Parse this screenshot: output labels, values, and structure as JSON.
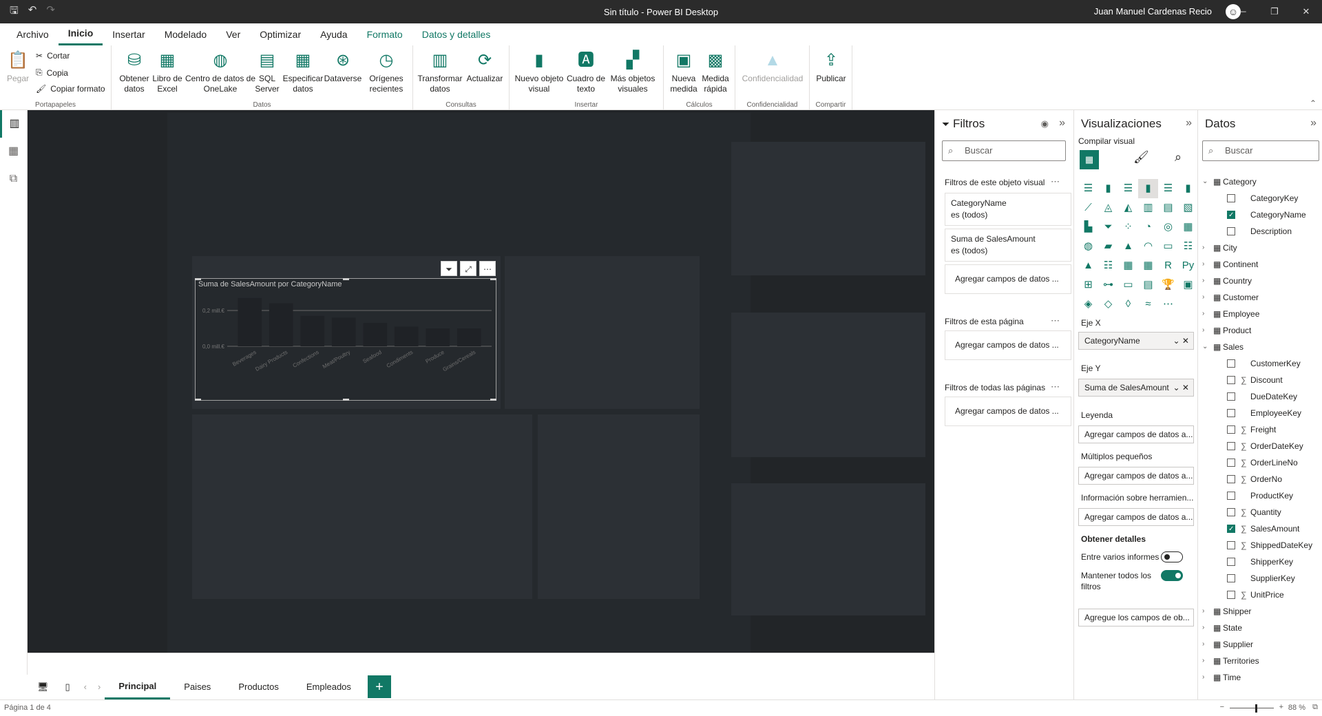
{
  "window": {
    "title": "Sin título - Power BI Desktop",
    "user": "Juan Manuel Cardenas Recio"
  },
  "menu": [
    "Archivo",
    "Inicio",
    "Insertar",
    "Modelado",
    "Ver",
    "Optimizar",
    "Ayuda",
    "Formato",
    "Datos y detalles"
  ],
  "ribbon": {
    "clipboard": {
      "paste": "Pegar",
      "cut": "Cortar",
      "copy": "Copia",
      "format_painter": "Copiar formato",
      "group": "Portapapeles"
    },
    "data": {
      "get_data": "Obtener datos",
      "excel": "Libro de Excel",
      "onelake": "Centro de datos de OneLake",
      "sql": "SQL Server",
      "enter_data": "Especificar datos",
      "dataverse": "Dataverse",
      "recent": "Orígenes recientes",
      "group": "Datos"
    },
    "queries": {
      "transform": "Transformar datos",
      "refresh": "Actualizar",
      "group": "Consultas"
    },
    "insert": {
      "new_visual": "Nuevo objeto visual",
      "textbox": "Cuadro de texto",
      "more_visuals": "Más objetos visuales",
      "group": "Insertar"
    },
    "calc": {
      "new_measure": "Nueva medida",
      "quick_measure": "Medida rápida",
      "group": "Cálculos"
    },
    "sensitivity": {
      "label": "Confidencialidad",
      "group": "Confidencialidad"
    },
    "share": {
      "publish": "Publicar",
      "group": "Compartir"
    }
  },
  "visual": {
    "title": "Suma de SalesAmount por CategoryName"
  },
  "chart_data": {
    "type": "bar",
    "title": "Suma de SalesAmount por CategoryName",
    "categories": [
      "Beverages",
      "Dairy Products",
      "Confections",
      "Meat/Poultry",
      "Seafood",
      "Condiments",
      "Produce",
      "Grains/Cereals"
    ],
    "values": [
      0.27,
      0.24,
      0.17,
      0.16,
      0.13,
      0.11,
      0.1,
      0.1
    ],
    "yticks": [
      "0,2 mill.€",
      "0,0 mill.€"
    ],
    "ylim": [
      0,
      0.3
    ],
    "grid": true
  },
  "tabs": [
    "Principal",
    "Paises",
    "Productos",
    "Empleados"
  ],
  "status": {
    "page": "Página 1 de 4",
    "zoom": "88 %"
  },
  "filters": {
    "title": "Filtros",
    "search": "Buscar",
    "visual_section": "Filtros de este objeto visual",
    "cards": [
      {
        "field": "CategoryName",
        "state": "es (todos)"
      },
      {
        "field": "Suma de SalesAmount",
        "state": "es (todos)"
      }
    ],
    "add": "Agregar campos de datos ...",
    "page_section": "Filtros de esta página",
    "all_section": "Filtros de todas las páginas"
  },
  "viz": {
    "title": "Visualizaciones",
    "build": "Compilar visual",
    "x_axis": "Eje X",
    "x_value": "CategoryName",
    "y_axis": "Eje Y",
    "y_value": "Suma de SalesAmount",
    "legend": "Leyenda",
    "add_fields": "Agregar campos de datos a...",
    "small_multiples": "Múltiplos pequeños",
    "tooltips": "Información sobre herramien...",
    "drill": "Obtener detalles",
    "cross_report": "Entre varios informes",
    "keep_filters": "Mantener todos los filtros",
    "drill_add": "Agregue los campos de ob..."
  },
  "data_pane": {
    "title": "Datos",
    "search": "Buscar",
    "tables": [
      {
        "name": "Category",
        "expanded": true,
        "fields": [
          {
            "name": "CategoryKey",
            "checked": false,
            "sigma": false
          },
          {
            "name": "CategoryName",
            "checked": true,
            "sigma": false
          },
          {
            "name": "Description",
            "checked": false,
            "sigma": false
          }
        ]
      },
      {
        "name": "City"
      },
      {
        "name": "Continent"
      },
      {
        "name": "Country"
      },
      {
        "name": "Customer"
      },
      {
        "name": "Employee"
      },
      {
        "name": "Product"
      },
      {
        "name": "Sales",
        "expanded": true,
        "fields": [
          {
            "name": "CustomerKey",
            "checked": false,
            "sigma": false
          },
          {
            "name": "Discount",
            "checked": false,
            "sigma": true
          },
          {
            "name": "DueDateKey",
            "checked": false,
            "sigma": false
          },
          {
            "name": "EmployeeKey",
            "checked": false,
            "sigma": false
          },
          {
            "name": "Freight",
            "checked": false,
            "sigma": true
          },
          {
            "name": "OrderDateKey",
            "checked": false,
            "sigma": true
          },
          {
            "name": "OrderLineNo",
            "checked": false,
            "sigma": true
          },
          {
            "name": "OrderNo",
            "checked": false,
            "sigma": true
          },
          {
            "name": "ProductKey",
            "checked": false,
            "sigma": false
          },
          {
            "name": "Quantity",
            "checked": false,
            "sigma": true
          },
          {
            "name": "SalesAmount",
            "checked": true,
            "sigma": true
          },
          {
            "name": "ShippedDateKey",
            "checked": false,
            "sigma": true
          },
          {
            "name": "ShipperKey",
            "checked": false,
            "sigma": false
          },
          {
            "name": "SupplierKey",
            "checked": false,
            "sigma": false
          },
          {
            "name": "UnitPrice",
            "checked": false,
            "sigma": true
          }
        ]
      },
      {
        "name": "Shipper"
      },
      {
        "name": "State"
      },
      {
        "name": "Supplier"
      },
      {
        "name": "Territories"
      },
      {
        "name": "Time"
      }
    ]
  }
}
